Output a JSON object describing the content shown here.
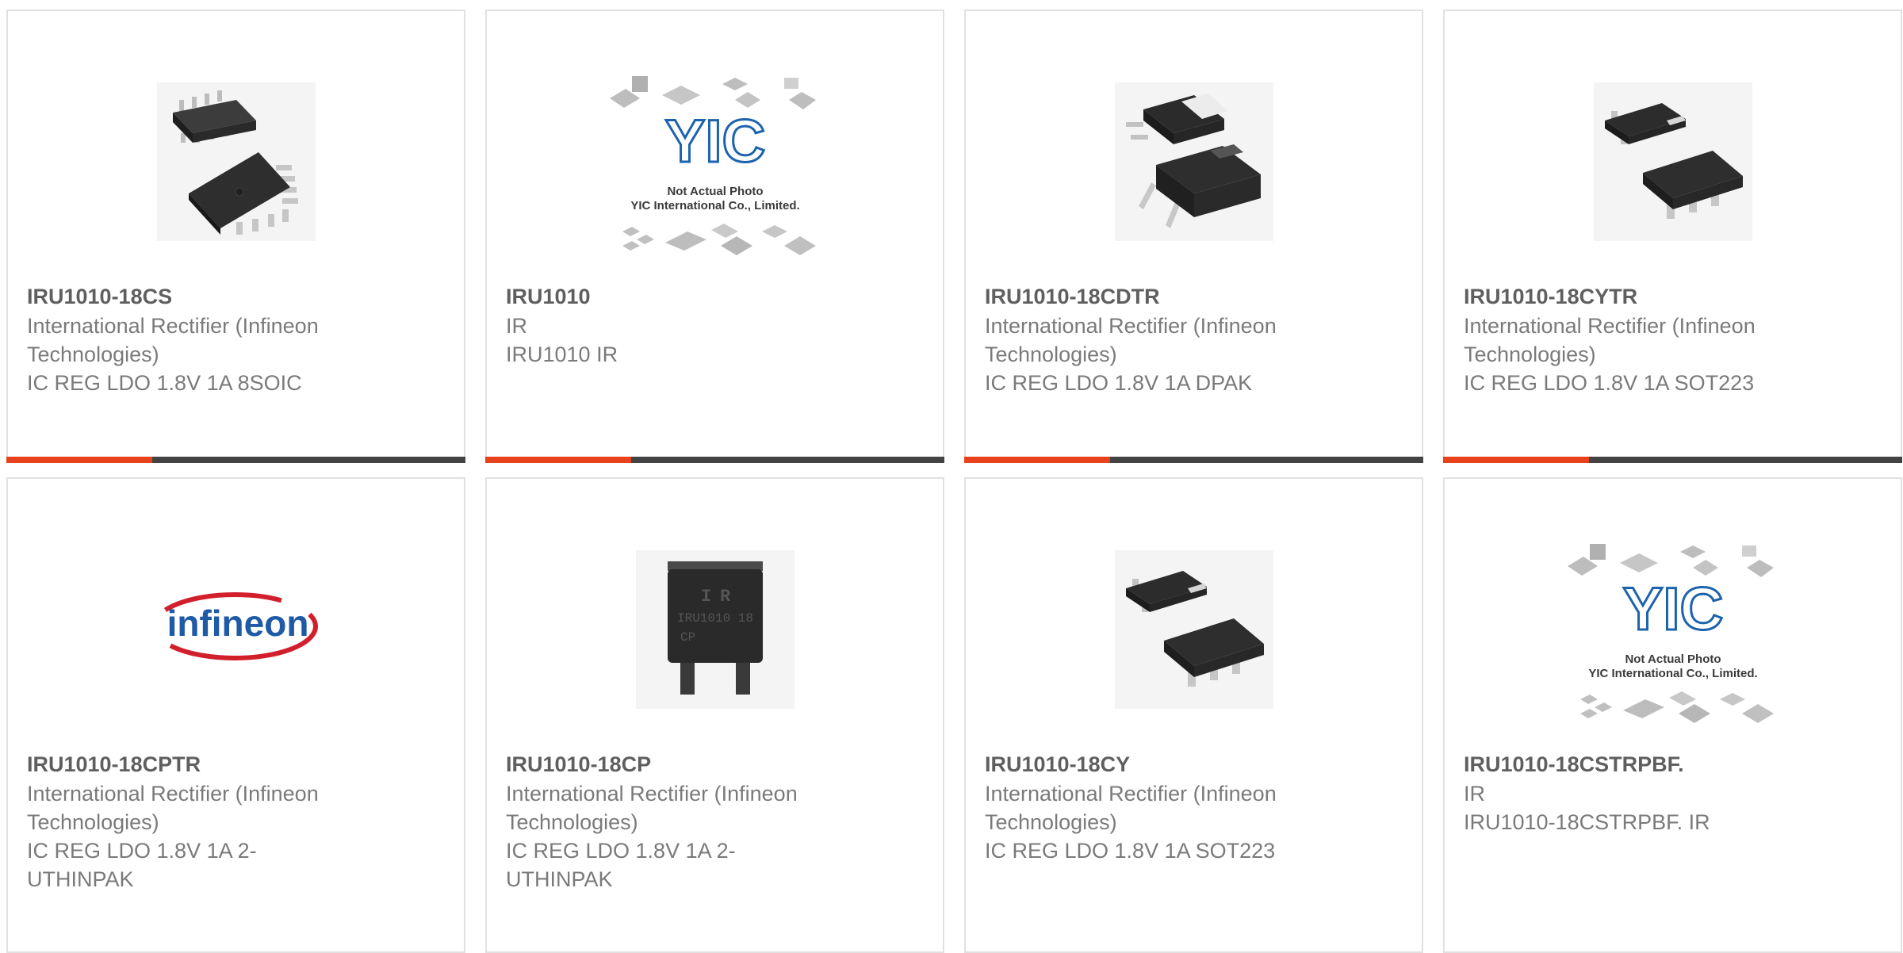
{
  "colors": {
    "accent": "#e8421c",
    "bar": "#434343",
    "border": "#e1e1e1",
    "text": "#7a7a7a",
    "title": "#5f5f5f"
  },
  "products": [
    {
      "part": "IRU1010-18CS",
      "lines": [
        "International Rectifier (Infineon",
        "Technologies)",
        "IC REG LDO 1.8V 1A 8SOIC"
      ],
      "image": "soic8-package"
    },
    {
      "part": "IRU1010",
      "lines": [
        "IR",
        "IRU1010 IR"
      ],
      "image": "not-actual-photo"
    },
    {
      "part": "IRU1010-18CDTR",
      "lines": [
        "International Rectifier (Infineon",
        "Technologies)",
        "IC REG LDO 1.8V 1A DPAK"
      ],
      "image": "dpak-package"
    },
    {
      "part": "IRU1010-18CYTR",
      "lines": [
        "International Rectifier (Infineon",
        "Technologies)",
        "IC REG LDO 1.8V 1A SOT223"
      ],
      "image": "sot223-package"
    },
    {
      "part": "IRU1010-18CPTR",
      "lines": [
        "International Rectifier (Infineon",
        "Technologies)",
        "IC REG LDO 1.8V 1A 2-",
        "UTHINPAK"
      ],
      "image": "infineon-logo"
    },
    {
      "part": "IRU1010-18CP",
      "lines": [
        "International Rectifier (Infineon",
        "Technologies)",
        "IC REG LDO 1.8V 1A 2-",
        "UTHINPAK"
      ],
      "image": "uthinpak-package"
    },
    {
      "part": "IRU1010-18CY",
      "lines": [
        "International Rectifier (Infineon",
        "Technologies)",
        "IC REG LDO 1.8V 1A SOT223"
      ],
      "image": "sot223-package"
    },
    {
      "part": "IRU1010-18CSTRPBF.",
      "lines": [
        "IR",
        "IRU1010-18CSTRPBF. IR"
      ],
      "image": "not-actual-photo"
    }
  ],
  "placeholder": {
    "brand": "YIC",
    "caption1": "Not Actual Photo",
    "caption2": "YIC International Co., Limited."
  },
  "logo_text": "infineon",
  "chip_marking": [
    "I",
    "R",
    "IRU1010 18",
    "CP"
  ]
}
